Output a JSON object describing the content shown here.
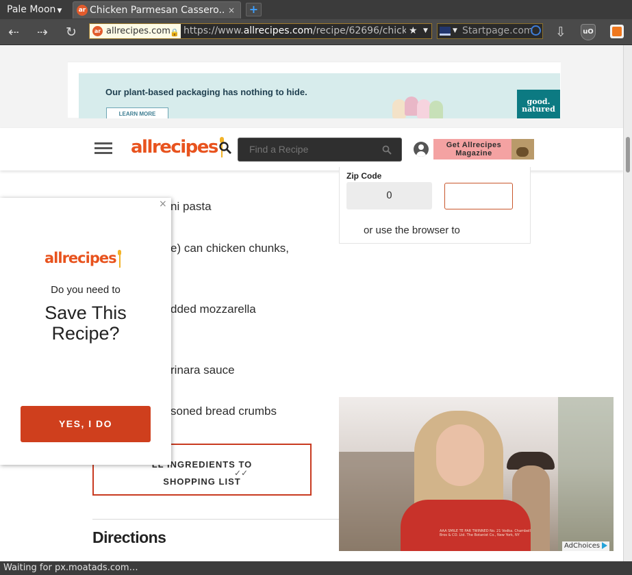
{
  "browser": {
    "menu_label": "Pale Moon",
    "tab_favicon": "ar",
    "tab_title": "Chicken Parmesan Cassero...",
    "tab_close": "×",
    "new_tab": "+",
    "identity_label": "allrecipes.com",
    "url_prefix": "https://www.",
    "url_domain": "allrecipes.com",
    "url_path": "/recipe/62696/chicke",
    "search_engine": "Startpage.com",
    "status_text": "Waiting for px.moatads.com…",
    "shield_label": "uO"
  },
  "ad_banner": {
    "headline": "Our plant-based packaging has nothing to hide.",
    "cta": "LEARN MORE",
    "brand_line1": "good.",
    "brand_line2": "natured"
  },
  "header": {
    "logo": "allrecipes",
    "search_placeholder": "Find a Recipe",
    "magazine_line1": "Get Allrecipes",
    "magazine_line2": "Magazine"
  },
  "zip_card": {
    "label": "Zip Code",
    "count": "0",
    "input_value": "",
    "browser_text": "or use the browser to"
  },
  "ingredients": [
    "ni pasta",
    "e) can chicken chunks,",
    "dded mozzarella",
    "rinara sauce",
    "soned bread crumbs"
  ],
  "shopping": {
    "line1": "LL INGREDIENTS TO",
    "line2": "SHOPPING LIST"
  },
  "directions_heading": "Directions",
  "popup": {
    "close": "×",
    "logo": "allrecipes",
    "question": "Do you need to",
    "title_line1": "Save This",
    "title_line2": "Recipe?",
    "button": "YES, I DO"
  },
  "video_ad": {
    "fine_print": "AAA SMILE TE PAR TWINNED No. 21 Vodka. Chambell Bros & CO. Ltd. The Botanist Co., New York, NY",
    "adchoices": "AdChoices"
  },
  "colors": {
    "brand_orange": "#e8531e",
    "button_red": "#cf3f1d",
    "spoon_yellow": "#f2b328"
  }
}
